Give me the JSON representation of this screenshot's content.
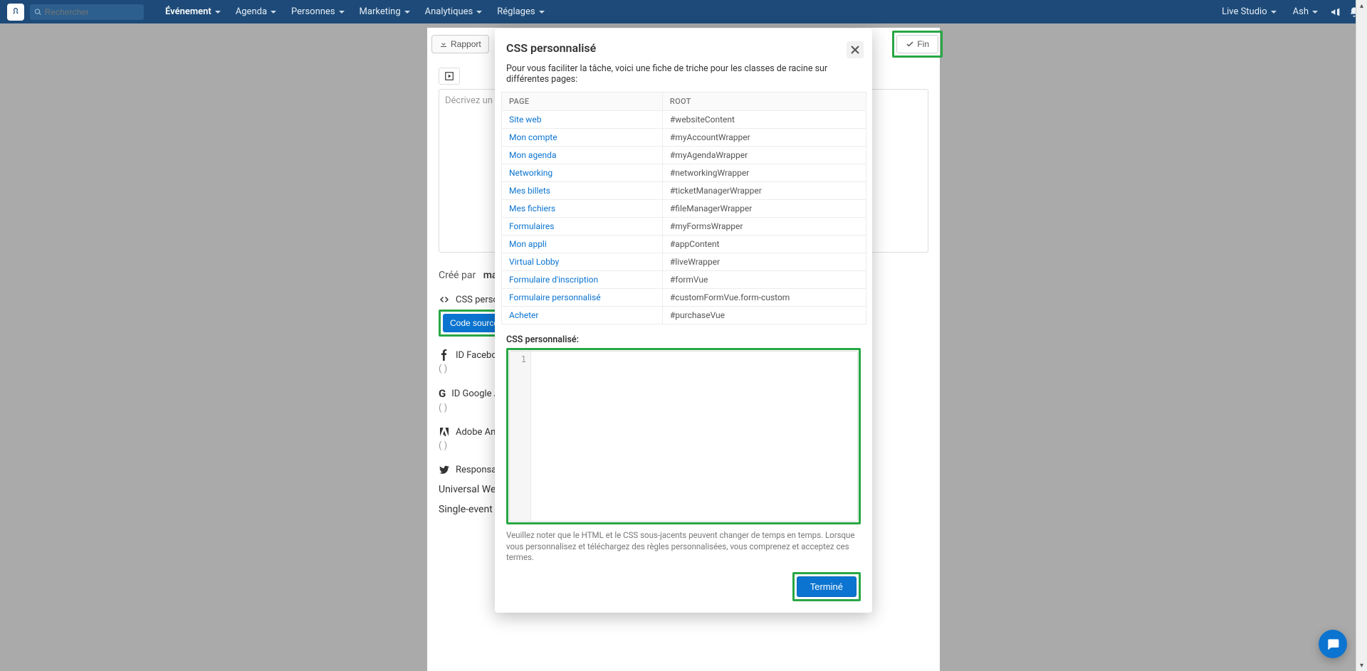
{
  "topbar": {
    "search_placeholder": "Rechercher",
    "nav": [
      "Événement",
      "Agenda",
      "Personnes",
      "Marketing",
      "Analytiques",
      "Réglages"
    ],
    "right": {
      "live_studio": "Live Studio",
      "user": "Ash"
    }
  },
  "bg": {
    "rapport": "Rapport",
    "fin": "Fin",
    "textarea_placeholder": "Décrivez un pe",
    "created_by_label": "Créé par",
    "created_by_name": "marcela",
    "css_section": "CSS personn",
    "code_source": "Code source",
    "fb_label": "ID Facebook",
    "ga_label": "ID Google A",
    "adobe_label": "Adobe Analy",
    "twitter_label": "Responsable",
    "uwt": "Universal Websit",
    "sewt": "Single-event Website Tag ID:",
    "paren": "( )"
  },
  "modal": {
    "title": "CSS personnalisé",
    "intro": "Pour vous faciliter la tâche, voici une fiche de triche pour les classes de racine sur différentes pages:",
    "th_page": "PAGE",
    "th_root": "ROOT",
    "rows": [
      {
        "page": "Site web",
        "root": "#websiteContent"
      },
      {
        "page": "Mon compte",
        "root": "#myAccountWrapper"
      },
      {
        "page": "Mon agenda",
        "root": "#myAgendaWrapper"
      },
      {
        "page": "Networking",
        "root": "#networkingWrapper"
      },
      {
        "page": "Mes billets",
        "root": "#ticketManagerWrapper"
      },
      {
        "page": "Mes fichiers",
        "root": "#fileManagerWrapper"
      },
      {
        "page": "Formulaires",
        "root": "#myFormsWrapper"
      },
      {
        "page": "Mon appli",
        "root": "#appContent"
      },
      {
        "page": "Virtual Lobby",
        "root": "#liveWrapper"
      },
      {
        "page": "Formulaire d'inscription",
        "root": "#formVue"
      },
      {
        "page": "Formulaire personnalisé",
        "root": "#customFormVue.form-custom"
      },
      {
        "page": "Acheter",
        "root": "#purchaseVue"
      }
    ],
    "css_label": "CSS personnalisé:",
    "gutter_1": "1",
    "disclaimer": "Veuillez noter que le HTML et le CSS sous-jacents peuvent changer de temps en temps. Lorsque vous personnalisez et téléchargez des règles personnalisées, vous comprenez et acceptez ces termes.",
    "done": "Terminé"
  }
}
